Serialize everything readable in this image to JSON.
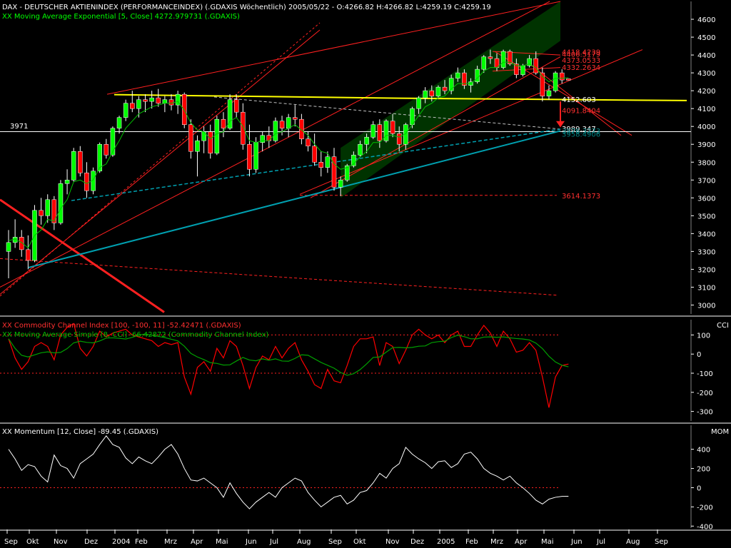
{
  "header": {
    "title_line": "DAX  - DEUTSCHER AKTIENINDEX (PERFORMANCEINDEX) (.GDAXIS  Wöchentlich) 2005/05/22 - O:4266.82 H:4266.82 L:4259.19 C:4259.19",
    "ema_line": "XX Moving Average Exponential [5, Close] 4272.979731 (.GDAXIS)"
  },
  "colors": {
    "background": "#000000",
    "up_candle": "#00ff00",
    "down_candle": "#ff0000",
    "support_line": "#ffff00",
    "trend_line": "#00a0b0",
    "channel_fill": "#003300",
    "cci_line": "#ff0000",
    "cci_ma_line": "#00a000",
    "momentum_line": "#ffffff",
    "panel_border": "#808080"
  },
  "chart_data": [
    {
      "type": "candlestick",
      "panel": "price",
      "title": "DAX  - DEUTSCHER AKTIENINDEX (PERFORMANCEINDEX) (.GDAXIS  Wöchentlich)",
      "ylim": [
        2950,
        4700
      ],
      "yticks": [
        3000,
        3100,
        3200,
        3300,
        3400,
        3500,
        3600,
        3700,
        3800,
        3900,
        4000,
        4100,
        4200,
        4300,
        4400,
        4500,
        4600
      ],
      "candles": [
        [
          3300,
          3420,
          3150,
          3350
        ],
        [
          3350,
          3480,
          3320,
          3380
        ],
        [
          3380,
          3420,
          3270,
          3310
        ],
        [
          3310,
          3390,
          3200,
          3250
        ],
        [
          3250,
          3560,
          3240,
          3530
        ],
        [
          3530,
          3600,
          3450,
          3500
        ],
        [
          3500,
          3620,
          3460,
          3590
        ],
        [
          3590,
          3610,
          3420,
          3460
        ],
        [
          3460,
          3700,
          3450,
          3680
        ],
        [
          3680,
          3760,
          3620,
          3700
        ],
        [
          3700,
          3880,
          3690,
          3860
        ],
        [
          3860,
          3890,
          3720,
          3740
        ],
        [
          3740,
          3800,
          3600,
          3640
        ],
        [
          3640,
          3770,
          3620,
          3750
        ],
        [
          3750,
          3910,
          3740,
          3900
        ],
        [
          3900,
          3930,
          3820,
          3840
        ],
        [
          3840,
          4000,
          3830,
          3990
        ],
        [
          3990,
          4060,
          3960,
          4050
        ],
        [
          4050,
          4150,
          4030,
          4130
        ],
        [
          4130,
          4200,
          4080,
          4100
        ],
        [
          4100,
          4170,
          4050,
          4150
        ],
        [
          4150,
          4180,
          4080,
          4140
        ],
        [
          4140,
          4200,
          4100,
          4160
        ],
        [
          4160,
          4210,
          4110,
          4130
        ],
        [
          4130,
          4170,
          4080,
          4150
        ],
        [
          4150,
          4180,
          4090,
          4120
        ],
        [
          4120,
          4200,
          4070,
          4180
        ],
        [
          4180,
          4190,
          3990,
          4010
        ],
        [
          4010,
          4040,
          3820,
          3860
        ],
        [
          3860,
          3950,
          3720,
          3920
        ],
        [
          3920,
          4000,
          3850,
          3970
        ],
        [
          3970,
          4010,
          3820,
          3850
        ],
        [
          3850,
          4060,
          3840,
          4040
        ],
        [
          4040,
          4080,
          3940,
          3990
        ],
        [
          3990,
          4180,
          3980,
          4150
        ],
        [
          4150,
          4180,
          4050,
          4080
        ],
        [
          4080,
          4130,
          3870,
          3900
        ],
        [
          3900,
          4010,
          3720,
          3760
        ],
        [
          3760,
          3940,
          3740,
          3910
        ],
        [
          3910,
          3970,
          3860,
          3950
        ],
        [
          3950,
          4000,
          3880,
          3920
        ],
        [
          3920,
          4050,
          3910,
          4030
        ],
        [
          4030,
          4060,
          3950,
          3990
        ],
        [
          3990,
          4070,
          3940,
          4050
        ],
        [
          4050,
          4120,
          4000,
          4040
        ],
        [
          4040,
          4070,
          3900,
          3930
        ],
        [
          3930,
          3970,
          3860,
          3890
        ],
        [
          3890,
          3960,
          3780,
          3800
        ],
        [
          3800,
          3860,
          3720,
          3770
        ],
        [
          3770,
          3860,
          3740,
          3830
        ],
        [
          3830,
          3880,
          3640,
          3660
        ],
        [
          3660,
          3720,
          3610,
          3700
        ],
        [
          3700,
          3790,
          3690,
          3780
        ],
        [
          3780,
          3860,
          3770,
          3840
        ],
        [
          3840,
          3920,
          3830,
          3900
        ],
        [
          3900,
          3960,
          3850,
          3940
        ],
        [
          3940,
          4030,
          3930,
          4010
        ],
        [
          4010,
          4040,
          3880,
          3920
        ],
        [
          3920,
          4040,
          3910,
          4030
        ],
        [
          4030,
          4070,
          3940,
          3960
        ],
        [
          3960,
          4000,
          3860,
          3900
        ],
        [
          3900,
          4020,
          3870,
          4010
        ],
        [
          4010,
          4110,
          3990,
          4100
        ],
        [
          4100,
          4170,
          4070,
          4160
        ],
        [
          4160,
          4220,
          4130,
          4200
        ],
        [
          4200,
          4230,
          4140,
          4170
        ],
        [
          4170,
          4230,
          4160,
          4220
        ],
        [
          4220,
          4260,
          4180,
          4200
        ],
        [
          4200,
          4290,
          4180,
          4270
        ],
        [
          4270,
          4330,
          4250,
          4300
        ],
        [
          4300,
          4320,
          4210,
          4230
        ],
        [
          4230,
          4270,
          4190,
          4250
        ],
        [
          4250,
          4340,
          4240,
          4320
        ],
        [
          4320,
          4400,
          4300,
          4390
        ],
        [
          4390,
          4430,
          4350,
          4380
        ],
        [
          4380,
          4410,
          4310,
          4330
        ],
        [
          4330,
          4430,
          4320,
          4420
        ],
        [
          4420,
          4430,
          4340,
          4350
        ],
        [
          4350,
          4380,
          4270,
          4290
        ],
        [
          4290,
          4350,
          4280,
          4340
        ],
        [
          4340,
          4400,
          4330,
          4380
        ],
        [
          4380,
          4420,
          4290,
          4300
        ],
        [
          4300,
          4330,
          4140,
          4170
        ],
        [
          4170,
          4230,
          4150,
          4200
        ],
        [
          4200,
          4310,
          4190,
          4300
        ],
        [
          4300,
          4320,
          4240,
          4260
        ],
        [
          4266.82,
          4266.82,
          4259.19,
          4259.19
        ]
      ],
      "ema": [
        3360,
        3370,
        3350,
        3320,
        3390,
        3420,
        3480,
        3470,
        3540,
        3590,
        3690,
        3700,
        3680,
        3700,
        3770,
        3790,
        3860,
        3920,
        3990,
        4030,
        4070,
        4090,
        4110,
        4120,
        4130,
        4130,
        4140,
        4090,
        4020,
        3980,
        3970,
        3930,
        3960,
        3970,
        4030,
        4050,
        4000,
        3920,
        3910,
        3920,
        3920,
        3960,
        3970,
        3990,
        4010,
        3980,
        3950,
        3900,
        3860,
        3850,
        3790,
        3760,
        3770,
        3790,
        3830,
        3860,
        3910,
        3910,
        3950,
        3950,
        3940,
        3960,
        4010,
        4060,
        4110,
        4130,
        4160,
        4170,
        4210,
        4240,
        4240,
        4240,
        4270,
        4310,
        4330,
        4330,
        4360,
        4360,
        4340,
        4340,
        4350,
        4330,
        4280,
        4250,
        4270,
        4270,
        4273
      ]
    },
    {
      "type": "line",
      "panel": "cci",
      "legend": [
        "XX Commodity Channel Index [100, -100, 11] -52.42471 (.GDAXIS)",
        "XX Moving Average Simple [8, CCI] -66.42872 (Commodity Channel Index)"
      ],
      "ylabel": "CCI",
      "ylim": [
        -350,
        180
      ],
      "yticks": [
        100,
        0,
        -100,
        -200,
        -300
      ],
      "reference_lines": [
        100,
        -100
      ],
      "cci": [
        80,
        -20,
        -80,
        -40,
        40,
        60,
        40,
        -30,
        100,
        140,
        160,
        30,
        -10,
        40,
        120,
        90,
        110,
        120,
        130,
        100,
        90,
        80,
        70,
        40,
        60,
        50,
        60,
        -120,
        -210,
        -70,
        -40,
        -90,
        30,
        -20,
        70,
        40,
        -60,
        -180,
        -70,
        -10,
        -30,
        40,
        -20,
        30,
        60,
        -30,
        -90,
        -160,
        -180,
        -80,
        -140,
        -150,
        -60,
        40,
        80,
        80,
        90,
        -60,
        60,
        40,
        -50,
        20,
        100,
        130,
        100,
        80,
        100,
        60,
        100,
        120,
        40,
        40,
        100,
        150,
        110,
        40,
        120,
        80,
        10,
        20,
        60,
        20,
        -120,
        -280,
        -120,
        -60,
        -52
      ]
    },
    {
      "type": "line",
      "panel": "momentum",
      "legend": "XX Momentum [12, Close] -89.45 (.GDAXIS)",
      "ylabel": "MOM",
      "ylim": [
        -420,
        650
      ],
      "yticks": [
        400,
        200,
        0,
        -200,
        -400
      ],
      "momentum": [
        400,
        300,
        180,
        240,
        220,
        120,
        60,
        340,
        230,
        200,
        100,
        250,
        300,
        350,
        450,
        540,
        450,
        420,
        310,
        250,
        320,
        280,
        250,
        320,
        400,
        450,
        350,
        200,
        80,
        70,
        100,
        50,
        0,
        -100,
        50,
        -60,
        -150,
        -220,
        -150,
        -100,
        -50,
        -100,
        0,
        50,
        100,
        70,
        -50,
        -130,
        -200,
        -150,
        -100,
        -80,
        -170,
        -130,
        -50,
        -30,
        50,
        150,
        100,
        200,
        250,
        420,
        350,
        300,
        260,
        200,
        270,
        280,
        210,
        250,
        350,
        370,
        300,
        200,
        150,
        120,
        80,
        120,
        50,
        0,
        -60,
        -130,
        -170,
        -120,
        -100,
        -90,
        -89
      ]
    }
  ],
  "x_axis": {
    "labels": [
      "Sep",
      "Okt",
      "Nov",
      "Dez",
      "2004",
      "Feb",
      "Mrz",
      "Apr",
      "Mai",
      "Jun",
      "Jul",
      "Aug",
      "Sep",
      "Okt",
      "Nov",
      "Dez",
      "2005",
      "Feb",
      "Mrz",
      "Apr",
      "Mai",
      "Jun",
      "Jul",
      "Aug",
      "Sep"
    ]
  },
  "annotations": {
    "support_label": "3971",
    "levels": [
      {
        "text": "4418.4239",
        "value": 4418,
        "color": "#ff3030"
      },
      {
        "text": "4406.5179",
        "value": 4406,
        "color": "#ff3030"
      },
      {
        "text": "4373.0533",
        "value": 4373,
        "color": "#ff3030"
      },
      {
        "text": "4332.2634",
        "value": 4332,
        "color": "#ff3030"
      },
      {
        "text": "4152.603",
        "value": 4152,
        "color": "#ffffff"
      },
      {
        "text": "4091.8404",
        "value": 4091,
        "color": "#ff3030"
      },
      {
        "text": "3989.347",
        "value": 3989,
        "color": "#ffffff"
      },
      {
        "text": "3976.3273",
        "value": 3976,
        "color": "#008080"
      },
      {
        "text": "3958.4906",
        "value": 3958,
        "color": "#008080"
      },
      {
        "text": "3614.1373",
        "value": 3614,
        "color": "#ff3030"
      }
    ]
  }
}
